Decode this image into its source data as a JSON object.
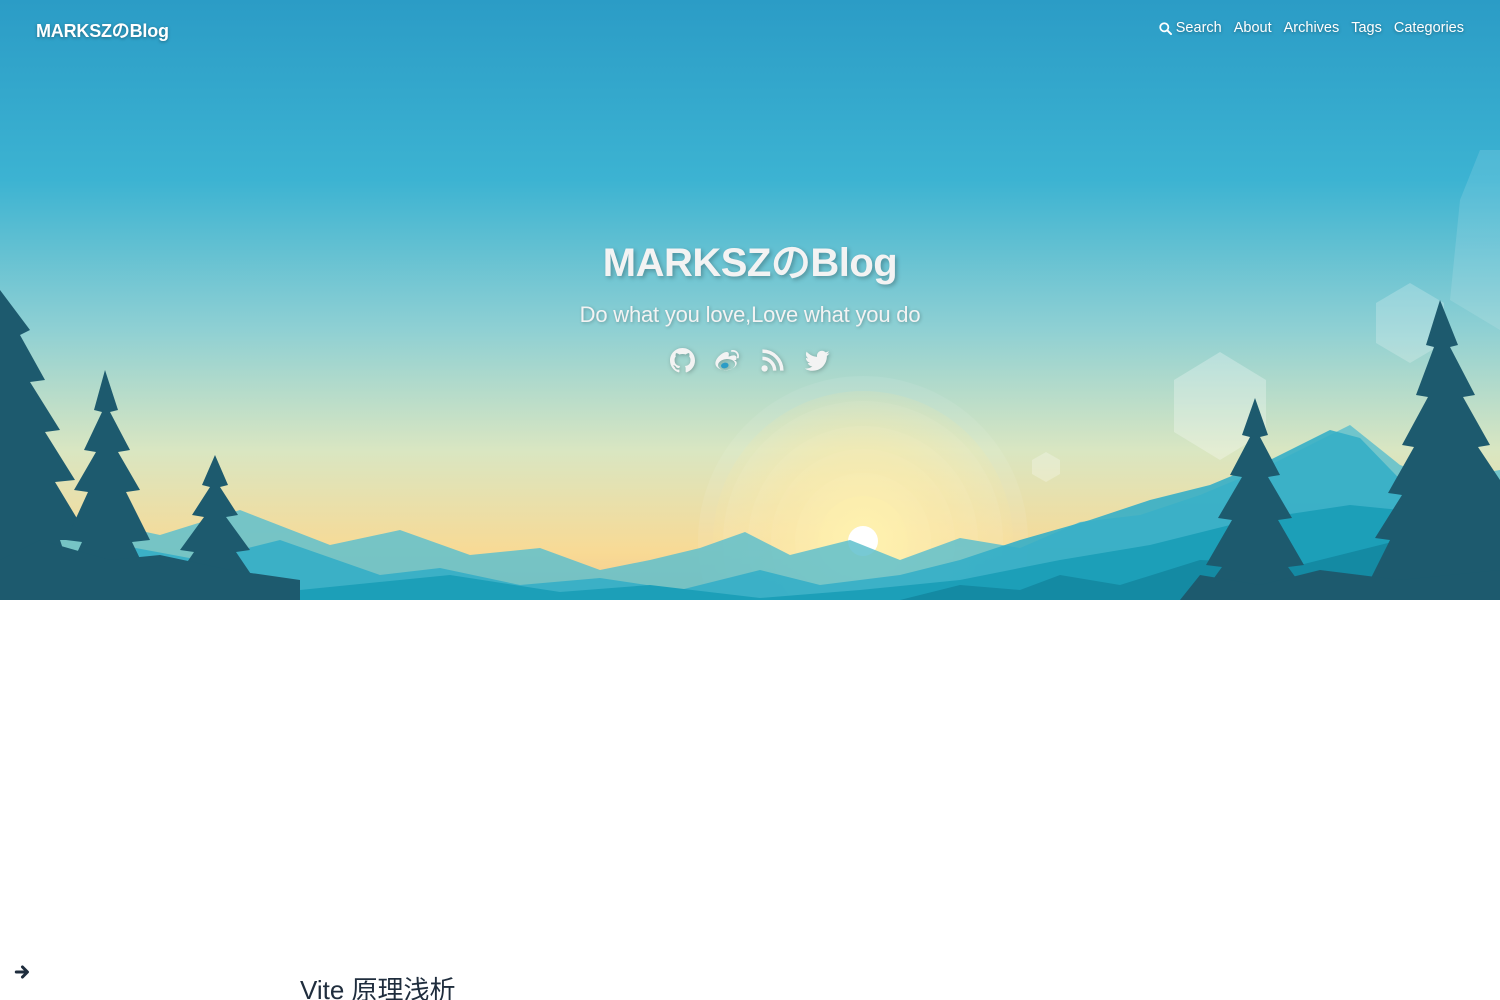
{
  "navbar": {
    "brand": "MARKSZのBlog",
    "menu": [
      {
        "label": "Search",
        "icon": "search-icon"
      },
      {
        "label": "About"
      },
      {
        "label": "Archives"
      },
      {
        "label": "Tags"
      },
      {
        "label": "Categories"
      }
    ]
  },
  "hero": {
    "title": "MARKSZのBlog",
    "subtitle": "Do what you love,Love what you do",
    "social": [
      {
        "icon": "github-icon"
      },
      {
        "icon": "weibo-icon"
      },
      {
        "icon": "rss-icon"
      },
      {
        "icon": "twitter-icon"
      }
    ]
  },
  "sidebar_toggle": {
    "icon": "arrow-right-icon"
  },
  "posts": [
    {
      "title": "Vite 原理浅析"
    }
  ],
  "colors": {
    "sky_top": "#2b9cc6",
    "sky_mid": "#5cc2d4",
    "horizon": "#f6dc98",
    "mountain_far": "#5fc0cc",
    "mountain_near": "#1c9fb8",
    "tree": "#1d5a6e",
    "text_light": "#f3f3f3",
    "post_title": "#1f2d3d"
  }
}
